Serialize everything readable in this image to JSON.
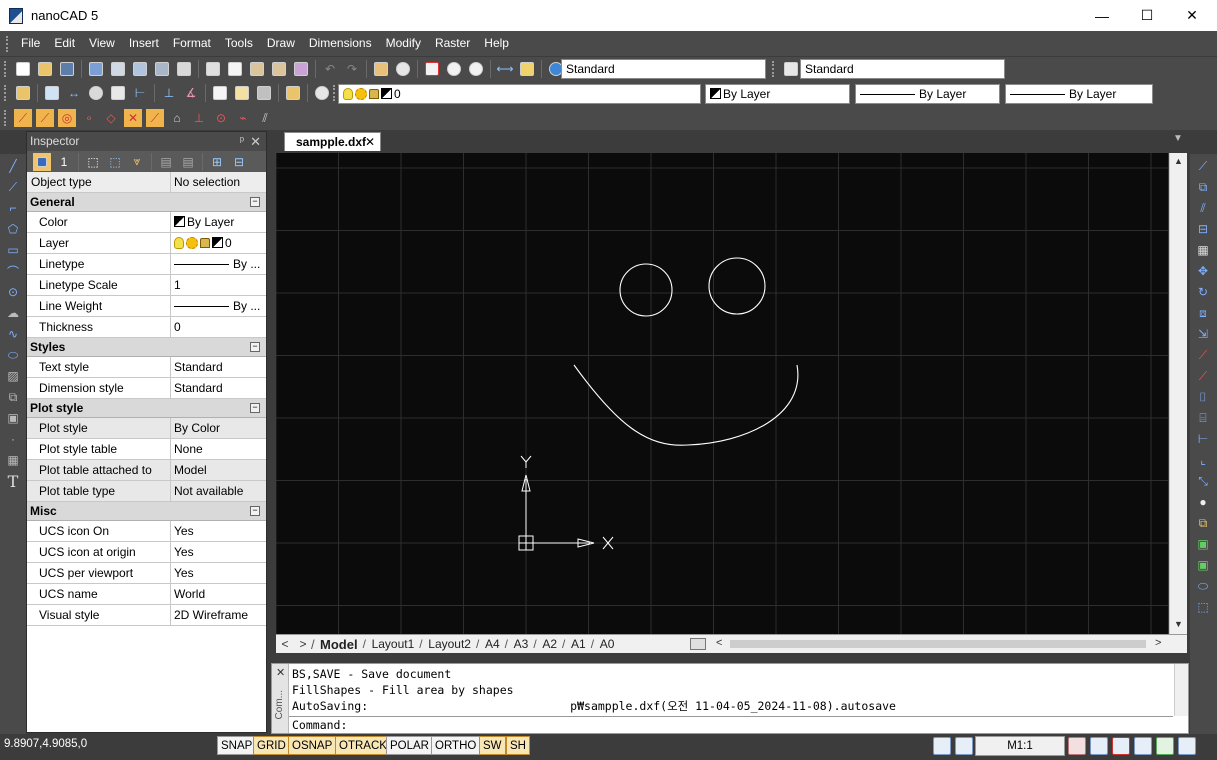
{
  "window": {
    "title": "nanoCAD 5",
    "minimize_glyph": "—",
    "maximize_glyph": "☐",
    "close_glyph": "✕"
  },
  "menu": {
    "items": [
      "File",
      "Edit",
      "View",
      "Insert",
      "Format",
      "Tools",
      "Draw",
      "Dimensions",
      "Modify",
      "Raster",
      "Help"
    ]
  },
  "toolbar": {
    "text_style": "Standard",
    "dim_style": "Standard",
    "layer": "0",
    "color": "By Layer",
    "linetype": "By Layer",
    "lineweight": "By Layer"
  },
  "inspector": {
    "title": "Inspector",
    "pin_glyph": "ᵖ",
    "close_glyph": "✕",
    "object_type": {
      "label": "Object type",
      "value": "No selection"
    },
    "sections": [
      {
        "name": "General",
        "rows": [
          {
            "label": "Color",
            "value": "By Layer",
            "swatch": true
          },
          {
            "label": "Layer",
            "value": "0",
            "layer_icons": true
          },
          {
            "label": "Linetype",
            "value": "By ...",
            "line": true
          },
          {
            "label": "Linetype Scale",
            "value": "1"
          },
          {
            "label": "Line Weight",
            "value": "By ...",
            "line": true
          },
          {
            "label": "Thickness",
            "value": "0"
          }
        ]
      },
      {
        "name": "Styles",
        "rows": [
          {
            "label": "Text style",
            "value": "Standard"
          },
          {
            "label": "Dimension style",
            "value": "Standard"
          }
        ]
      },
      {
        "name": "Plot style",
        "rows": [
          {
            "label": "Plot style",
            "value": "By Color",
            "alt": true
          },
          {
            "label": "Plot style table",
            "value": "None"
          },
          {
            "label": "Plot table attached to",
            "value": "Model",
            "alt": true
          },
          {
            "label": "Plot table type",
            "value": "Not available",
            "alt": true
          }
        ]
      },
      {
        "name": "Misc",
        "rows": [
          {
            "label": "UCS icon On",
            "value": "Yes"
          },
          {
            "label": "UCS icon at origin",
            "value": "Yes"
          },
          {
            "label": "UCS per viewport",
            "value": "Yes"
          },
          {
            "label": "UCS name",
            "value": "World"
          },
          {
            "label": "Visual style",
            "value": "2D Wireframe"
          }
        ]
      }
    ]
  },
  "document": {
    "tab_title": "sampple.dxf",
    "tab_close": "✕",
    "ucs_x": "X",
    "ucs_y": "Y"
  },
  "layout_tabs": [
    "Model",
    "Layout1",
    "Layout2",
    "A4",
    "A3",
    "A2",
    "A1",
    "A0"
  ],
  "command": {
    "side_label": "Com...",
    "lines": [
      "BS,SAVE - Save document",
      "FillShapes - Fill area by shapes"
    ],
    "autosave_prefix": "AutoSaving:",
    "autosave_suffix": "p₩sampple.dxf(오전 11-04-05_2024-11-08).autosave",
    "prompt": "Command:"
  },
  "status": {
    "coords": "9.8907,4.9085,0",
    "buttons": [
      {
        "label": "SNAP",
        "on": false
      },
      {
        "label": "GRID",
        "on": true
      },
      {
        "label": "OSNAP",
        "on": true
      },
      {
        "label": "OTRACK",
        "on": true
      },
      {
        "label": "POLAR",
        "on": false
      },
      {
        "label": "ORTHO",
        "on": false
      },
      {
        "label": "SW",
        "on": true
      },
      {
        "label": "SH",
        "on": true
      }
    ],
    "scale": "M1:1"
  },
  "colors": {
    "canvas_bg": "#0b0b0b",
    "grid": "#2e2e2e",
    "drawing": "#ffffff",
    "status_on": "#f9e6b5"
  }
}
